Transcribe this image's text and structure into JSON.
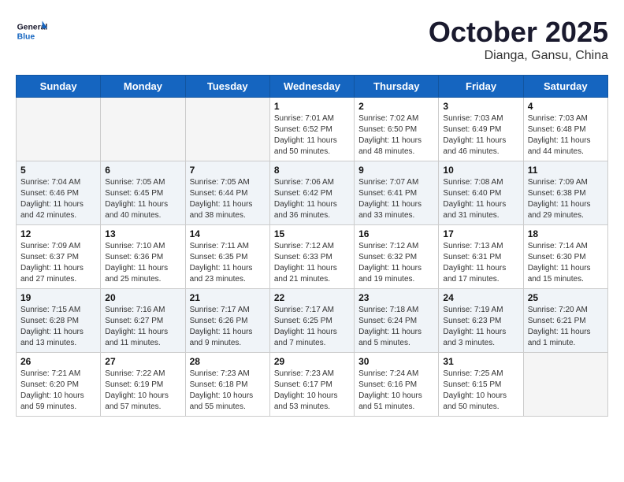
{
  "header": {
    "logo_line1": "General",
    "logo_line2": "Blue",
    "month": "October 2025",
    "location": "Dianga, Gansu, China"
  },
  "weekdays": [
    "Sunday",
    "Monday",
    "Tuesday",
    "Wednesday",
    "Thursday",
    "Friday",
    "Saturday"
  ],
  "weeks": [
    [
      {
        "day": "",
        "info": ""
      },
      {
        "day": "",
        "info": ""
      },
      {
        "day": "",
        "info": ""
      },
      {
        "day": "1",
        "info": "Sunrise: 7:01 AM\nSunset: 6:52 PM\nDaylight: 11 hours\nand 50 minutes."
      },
      {
        "day": "2",
        "info": "Sunrise: 7:02 AM\nSunset: 6:50 PM\nDaylight: 11 hours\nand 48 minutes."
      },
      {
        "day": "3",
        "info": "Sunrise: 7:03 AM\nSunset: 6:49 PM\nDaylight: 11 hours\nand 46 minutes."
      },
      {
        "day": "4",
        "info": "Sunrise: 7:03 AM\nSunset: 6:48 PM\nDaylight: 11 hours\nand 44 minutes."
      }
    ],
    [
      {
        "day": "5",
        "info": "Sunrise: 7:04 AM\nSunset: 6:46 PM\nDaylight: 11 hours\nand 42 minutes."
      },
      {
        "day": "6",
        "info": "Sunrise: 7:05 AM\nSunset: 6:45 PM\nDaylight: 11 hours\nand 40 minutes."
      },
      {
        "day": "7",
        "info": "Sunrise: 7:05 AM\nSunset: 6:44 PM\nDaylight: 11 hours\nand 38 minutes."
      },
      {
        "day": "8",
        "info": "Sunrise: 7:06 AM\nSunset: 6:42 PM\nDaylight: 11 hours\nand 36 minutes."
      },
      {
        "day": "9",
        "info": "Sunrise: 7:07 AM\nSunset: 6:41 PM\nDaylight: 11 hours\nand 33 minutes."
      },
      {
        "day": "10",
        "info": "Sunrise: 7:08 AM\nSunset: 6:40 PM\nDaylight: 11 hours\nand 31 minutes."
      },
      {
        "day": "11",
        "info": "Sunrise: 7:09 AM\nSunset: 6:38 PM\nDaylight: 11 hours\nand 29 minutes."
      }
    ],
    [
      {
        "day": "12",
        "info": "Sunrise: 7:09 AM\nSunset: 6:37 PM\nDaylight: 11 hours\nand 27 minutes."
      },
      {
        "day": "13",
        "info": "Sunrise: 7:10 AM\nSunset: 6:36 PM\nDaylight: 11 hours\nand 25 minutes."
      },
      {
        "day": "14",
        "info": "Sunrise: 7:11 AM\nSunset: 6:35 PM\nDaylight: 11 hours\nand 23 minutes."
      },
      {
        "day": "15",
        "info": "Sunrise: 7:12 AM\nSunset: 6:33 PM\nDaylight: 11 hours\nand 21 minutes."
      },
      {
        "day": "16",
        "info": "Sunrise: 7:12 AM\nSunset: 6:32 PM\nDaylight: 11 hours\nand 19 minutes."
      },
      {
        "day": "17",
        "info": "Sunrise: 7:13 AM\nSunset: 6:31 PM\nDaylight: 11 hours\nand 17 minutes."
      },
      {
        "day": "18",
        "info": "Sunrise: 7:14 AM\nSunset: 6:30 PM\nDaylight: 11 hours\nand 15 minutes."
      }
    ],
    [
      {
        "day": "19",
        "info": "Sunrise: 7:15 AM\nSunset: 6:28 PM\nDaylight: 11 hours\nand 13 minutes."
      },
      {
        "day": "20",
        "info": "Sunrise: 7:16 AM\nSunset: 6:27 PM\nDaylight: 11 hours\nand 11 minutes."
      },
      {
        "day": "21",
        "info": "Sunrise: 7:17 AM\nSunset: 6:26 PM\nDaylight: 11 hours\nand 9 minutes."
      },
      {
        "day": "22",
        "info": "Sunrise: 7:17 AM\nSunset: 6:25 PM\nDaylight: 11 hours\nand 7 minutes."
      },
      {
        "day": "23",
        "info": "Sunrise: 7:18 AM\nSunset: 6:24 PM\nDaylight: 11 hours\nand 5 minutes."
      },
      {
        "day": "24",
        "info": "Sunrise: 7:19 AM\nSunset: 6:23 PM\nDaylight: 11 hours\nand 3 minutes."
      },
      {
        "day": "25",
        "info": "Sunrise: 7:20 AM\nSunset: 6:21 PM\nDaylight: 11 hours\nand 1 minute."
      }
    ],
    [
      {
        "day": "26",
        "info": "Sunrise: 7:21 AM\nSunset: 6:20 PM\nDaylight: 10 hours\nand 59 minutes."
      },
      {
        "day": "27",
        "info": "Sunrise: 7:22 AM\nSunset: 6:19 PM\nDaylight: 10 hours\nand 57 minutes."
      },
      {
        "day": "28",
        "info": "Sunrise: 7:23 AM\nSunset: 6:18 PM\nDaylight: 10 hours\nand 55 minutes."
      },
      {
        "day": "29",
        "info": "Sunrise: 7:23 AM\nSunset: 6:17 PM\nDaylight: 10 hours\nand 53 minutes."
      },
      {
        "day": "30",
        "info": "Sunrise: 7:24 AM\nSunset: 6:16 PM\nDaylight: 10 hours\nand 51 minutes."
      },
      {
        "day": "31",
        "info": "Sunrise: 7:25 AM\nSunset: 6:15 PM\nDaylight: 10 hours\nand 50 minutes."
      },
      {
        "day": "",
        "info": ""
      }
    ]
  ]
}
